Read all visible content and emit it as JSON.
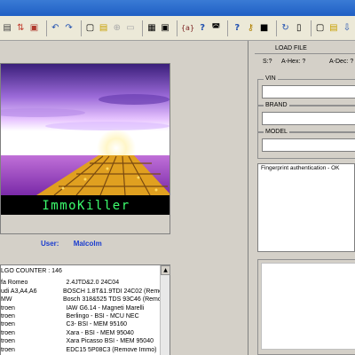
{
  "toolbar": {
    "icons": [
      "pages-icon",
      "sort-icon",
      "folder-icon",
      "undo-icon",
      "redo-icon",
      "open-icon",
      "save-icon",
      "binoculars-icon",
      "print-icon",
      "calculator-icon",
      "chip-icon",
      "braces-icon",
      "help-icon",
      "car-icon",
      "help2-icon",
      "key-icon",
      "module-icon",
      "refresh-icon",
      "reset-icon",
      "copy-icon",
      "paste-icon",
      "download-icon"
    ]
  },
  "image": {
    "banner_text": "ImmoKiller"
  },
  "user": {
    "label": "User:",
    "name": "Malcolm"
  },
  "list": {
    "header": "LGO COUNTER : 146",
    "rows": [
      {
        "make": "fa Romeo",
        "model": "2.4JTD&2.0    24C04"
      },
      {
        "make": "udi A3,A4,A6",
        "model": "BOSCH 1.8T&1.9TDI    24C02 (Remov"
      },
      {
        "make": "MW",
        "model": "Bosch 318&525 TDS 93C46 (Remove"
      },
      {
        "make": "troen",
        "model": "IAW G6.14 - Magneti Marelli"
      },
      {
        "make": "troen",
        "model": "Berlingo - BSI - MCU NEC"
      },
      {
        "make": "troen",
        "model": "C3- BSI - MEM 95160"
      },
      {
        "make": "troen",
        "model": "Xara - BSI - MEM 95040"
      },
      {
        "make": "troen",
        "model": "Xara Picasso    BSI - MEM 95040"
      },
      {
        "make": "troen",
        "model": "EDC15 5P08C3 (Remove Immo)"
      }
    ]
  },
  "right": {
    "load_label": "LOAD FILE",
    "s_label": "S:?",
    "ahex_label": "A-Hex: ?",
    "adec_label": "A-Dec: ?",
    "vin_label": "VIN",
    "vin_value": "",
    "brand_label": "BRAND",
    "brand_value": "",
    "model_label": "MODEL",
    "model_value": "",
    "log_text": "Fingerprint authentication - OK"
  },
  "colors": {
    "titlebar": "#1f5fc4",
    "user_text": "#1a3ccf",
    "banner_green": "#3cff6e"
  }
}
